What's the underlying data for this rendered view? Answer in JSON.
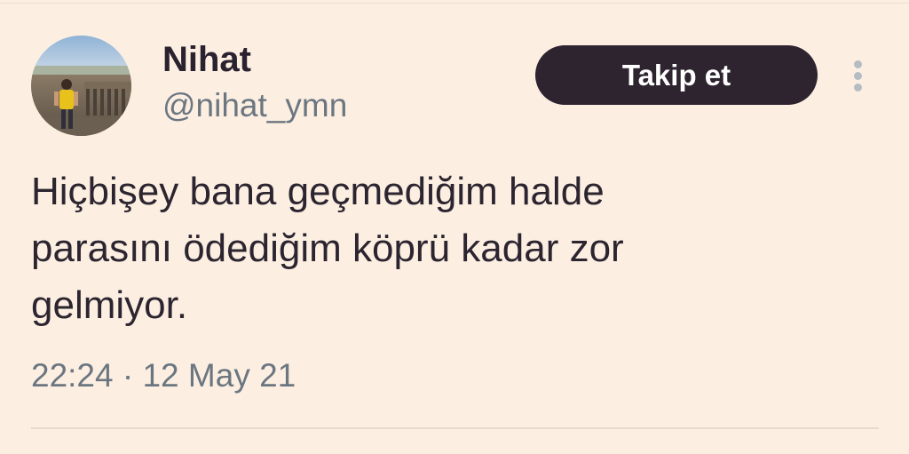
{
  "author": {
    "name": "Nihat",
    "handle": "@nihat_ymn",
    "avatar_icon": "profile-photo"
  },
  "follow_button": {
    "label": "Takip et"
  },
  "more_icon": "more-vertical-icon",
  "tweet": {
    "text_lines": [
      "Hiçbişey bana geçmediğim halde",
      "parasını ödediğim köprü kadar zor",
      "gelmiyor."
    ],
    "time": "22:24",
    "separator": "·",
    "date": "12 May 21"
  },
  "colors": {
    "background": "#fcefe2",
    "button": "#2e2430",
    "text": "#2c2530",
    "muted": "#6c7680"
  }
}
